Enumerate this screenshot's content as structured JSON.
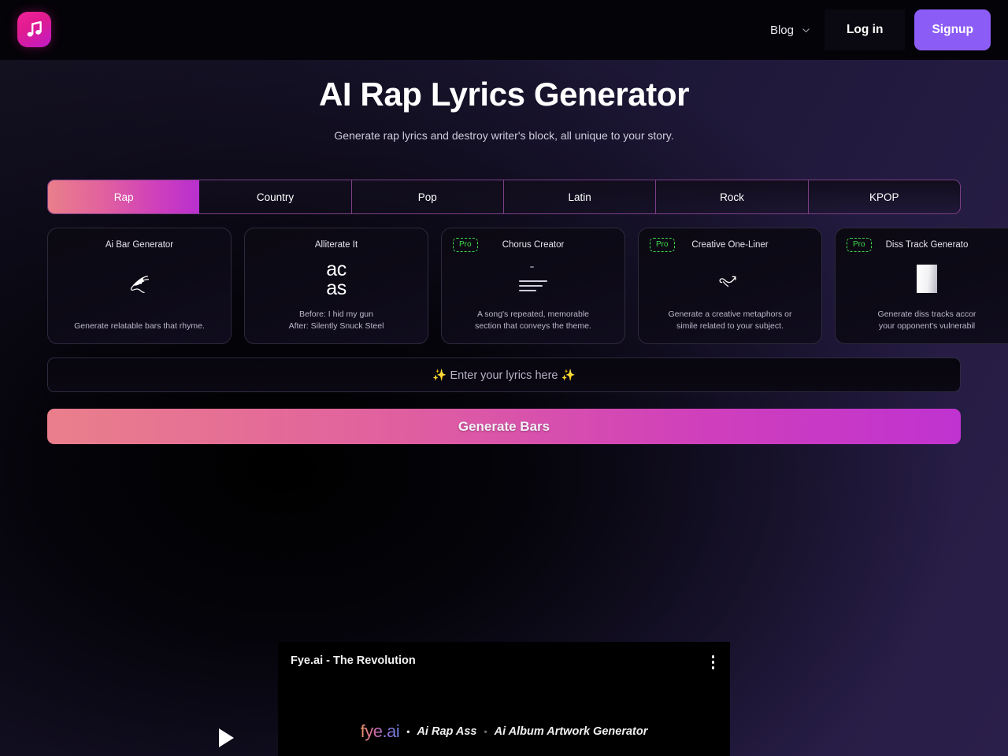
{
  "header": {
    "logo_icon": "music-note-icon",
    "nav": {
      "blog_label": "Blog",
      "blog_chevron": "chevron-down-icon",
      "login_label": "Log in",
      "signup_label": "Signup"
    },
    "accent_signup_color": "#8b5cf6"
  },
  "hero": {
    "title": "AI Rap Lyrics Generator",
    "subtitle": "Generate rap lyrics and destroy writer's block, all unique to your story."
  },
  "tabs": {
    "active_index": 0,
    "items": [
      {
        "label": "Rap"
      },
      {
        "label": "Country"
      },
      {
        "label": "Pop"
      },
      {
        "label": "Latin"
      },
      {
        "label": "Rock"
      },
      {
        "label": "KPOP"
      }
    ],
    "active_gradient_from": "#ea7f8b",
    "active_gradient_to": "#b830cf",
    "border_color": "#7d3f86"
  },
  "cards": [
    {
      "title": "Ai Bar Generator",
      "desc": "Generate relatable bars that rhyme.",
      "icon": "quill-pen-icon",
      "pro": false
    },
    {
      "title": "Alliterate It",
      "desc": "Before: I hid my gun\nAfter: Silently Snuck Steel",
      "desc_line1": "Before: I hid my gun",
      "desc_line2": "After: Silently Snuck Steel",
      "glyph_line1": "ac",
      "glyph_line2": "as",
      "icon": "alliteration-glyph-icon",
      "pro": false
    },
    {
      "title": "Chorus Creator",
      "desc": "A song's repeated, memorable section that conveys the theme.",
      "desc_line1": "A song's repeated, memorable",
      "desc_line2": "section that conveys the theme.",
      "icon": "text-lines-icon",
      "pro": true,
      "pro_label": "Pro"
    },
    {
      "title": "Creative One-Liner",
      "desc": "Generate a creative metaphors or simile related to your subject.",
      "desc_line1": "Generate a creative metaphors or",
      "desc_line2": "simile related to your subject.",
      "icon": "curved-arrow-icon",
      "pro": true,
      "pro_label": "Pro"
    },
    {
      "title": "Diss Track Generato",
      "desc": "Generate diss tracks accor your opponent's vulnerabil",
      "desc_line1": "Generate diss tracks accor",
      "desc_line2": "your opponent's vulnerabil",
      "icon": "white-card-icon",
      "pro": true,
      "pro_label": "Pro"
    }
  ],
  "lyrics_input": {
    "placeholder": "✨ Enter your lyrics here ✨",
    "value": ""
  },
  "generate_button": {
    "label": "Generate Bars"
  },
  "video_player": {
    "title": "Fye.ai - The Revolution",
    "menu_icon": "kebab-menu-icon",
    "play_icon": "play-triangle-icon",
    "brand": "fye.ai",
    "bullet": "•",
    "caption_left": "Ai Rap Ass",
    "caption_right": "Ai Album Artwork Generator"
  },
  "colors": {
    "pro_green": "#3ddc4a",
    "brand_pink": "#e01b8f",
    "purple": "#8b5cf6"
  }
}
